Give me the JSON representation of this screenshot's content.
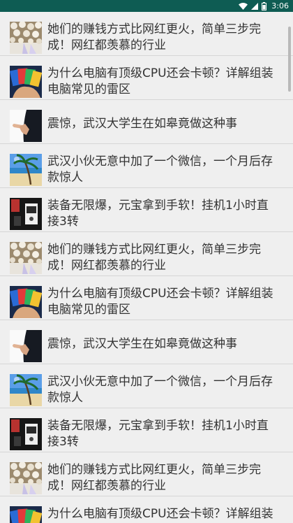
{
  "status_bar": {
    "time": "3:06",
    "icons": [
      "wifi-icon",
      "signal-icon",
      "battery-icon"
    ]
  },
  "colors": {
    "status_bar": "#0e5c53",
    "background": "#efefef",
    "divider": "#d6d6d6",
    "text": "#333333"
  },
  "list": {
    "items": [
      {
        "thumb": "cotton-flowers-thumbnail",
        "title": "她们的赚钱方式比网红更火，简单三步完成！网红都羡慕的行业"
      },
      {
        "thumb": "cards-in-hand-thumbnail",
        "title": "为什么电脑有顶级CPU还会卡顿？详解组装电脑常见的雷区"
      },
      {
        "thumb": "hand-pointing-thumbnail",
        "title": "震惊，武汉大学生在如皋竟做这种事"
      },
      {
        "thumb": "beach-palm-thumbnail",
        "title": "武汉小伙无意中加了一个微信，一个月后存款惊人"
      },
      {
        "thumb": "game-gear-thumbnail",
        "title": "装备无限爆，元宝拿到手软！挂机1小时直接3转"
      },
      {
        "thumb": "cotton-flowers-thumbnail",
        "title": "她们的赚钱方式比网红更火，简单三步完成！网红都羡慕的行业"
      },
      {
        "thumb": "cards-in-hand-thumbnail",
        "title": "为什么电脑有顶级CPU还会卡顿？详解组装电脑常见的雷区"
      },
      {
        "thumb": "hand-pointing-thumbnail",
        "title": "震惊，武汉大学生在如皋竟做这种事"
      },
      {
        "thumb": "beach-palm-thumbnail",
        "title": "武汉小伙无意中加了一个微信，一个月后存款惊人"
      },
      {
        "thumb": "game-gear-thumbnail",
        "title": "装备无限爆，元宝拿到手软！挂机1小时直接3转"
      },
      {
        "thumb": "cotton-flowers-thumbnail",
        "title": "她们的赚钱方式比网红更火，简单三步完成！网红都羡慕的行业"
      },
      {
        "thumb": "cards-in-hand-thumbnail",
        "title": "为什么电脑有顶级CPU还会卡顿？详解组装电脑常见的雷区"
      }
    ]
  }
}
